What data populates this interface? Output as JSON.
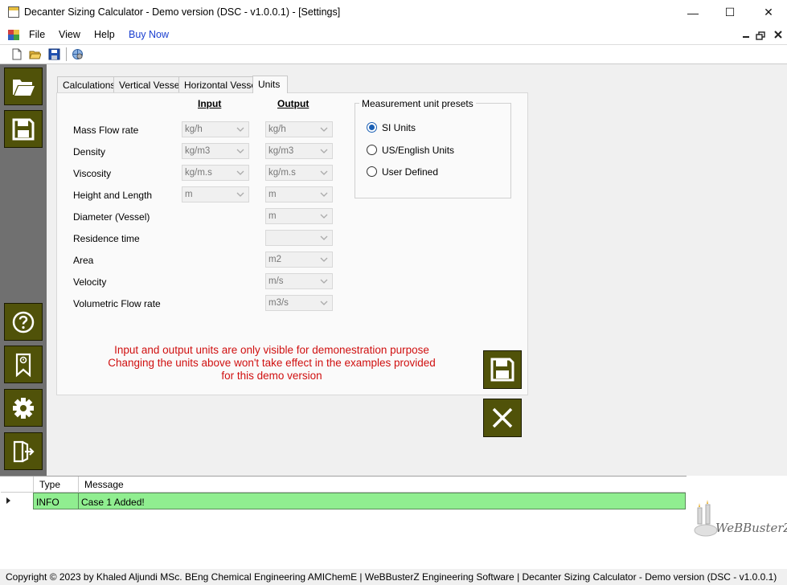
{
  "window": {
    "title": "Decanter Sizing Calculator - Demo version (DSC - v1.0.0.1) - [Settings]",
    "controls": {
      "minimize": "—",
      "maximize": "☐",
      "close": "✕"
    }
  },
  "menu": {
    "items": [
      "File",
      "View",
      "Help",
      "Buy Now"
    ],
    "buy_now_color": "#1a3fd0"
  },
  "toolbar": {
    "icons": [
      "new-file-icon",
      "open-folder-icon",
      "save-icon",
      "settings-globe-icon"
    ]
  },
  "sidebar": {
    "top_icons": [
      "open-folder-icon",
      "save-icon"
    ],
    "bottom_icons": [
      "help-icon",
      "about-icon",
      "settings-gear-icon",
      "exit-icon"
    ]
  },
  "tabs": [
    "Calculations",
    "Vertical Vessel",
    "Horizontal Vessel",
    "Units"
  ],
  "units": {
    "input_header": "Input",
    "output_header": "Output",
    "rows": [
      {
        "label": "Mass Flow rate",
        "input": "kg/h",
        "output": "kg/h"
      },
      {
        "label": "Density",
        "input": "kg/m3",
        "output": "kg/m3"
      },
      {
        "label": "Viscosity",
        "input": "kg/m.s",
        "output": "kg/m.s"
      },
      {
        "label": "Height and Length",
        "input": "m",
        "output": "m"
      },
      {
        "label": "Diameter (Vessel)",
        "input": null,
        "output": "m"
      },
      {
        "label": "Residence time",
        "input": null,
        "output": ""
      },
      {
        "label": "Area",
        "input": null,
        "output": "m2"
      },
      {
        "label": "Velocity",
        "input": null,
        "output": "m/s"
      },
      {
        "label": "Volumetric Flow rate",
        "input": null,
        "output": "m3/s"
      }
    ]
  },
  "presets": {
    "title": "Measurement unit presets",
    "options": [
      "SI Units",
      "US/English Units",
      "User Defined"
    ],
    "selected": "SI Units"
  },
  "notice": {
    "lines": [
      "Input and output units are only visible for demonestration purpose",
      "Changing the units above won't take effect in the examples provided",
      "for this demo version"
    ],
    "color": "#d01010"
  },
  "log": {
    "columns": [
      "Type",
      "Message"
    ],
    "rows": [
      {
        "type": "INFO",
        "message": "Case 1 Added!"
      }
    ],
    "row_color": "#90ee90"
  },
  "logo": {
    "text": "WeBBusterZ"
  },
  "status": "Copyright © 2023 by Khaled Aljundi MSc. BEng Chemical Engineering AMIChemE | WeBBusterZ Engineering Software  |  Decanter Sizing Calculator - Demo version (DSC - v1.0.0.1)",
  "accent_color": "#505209"
}
